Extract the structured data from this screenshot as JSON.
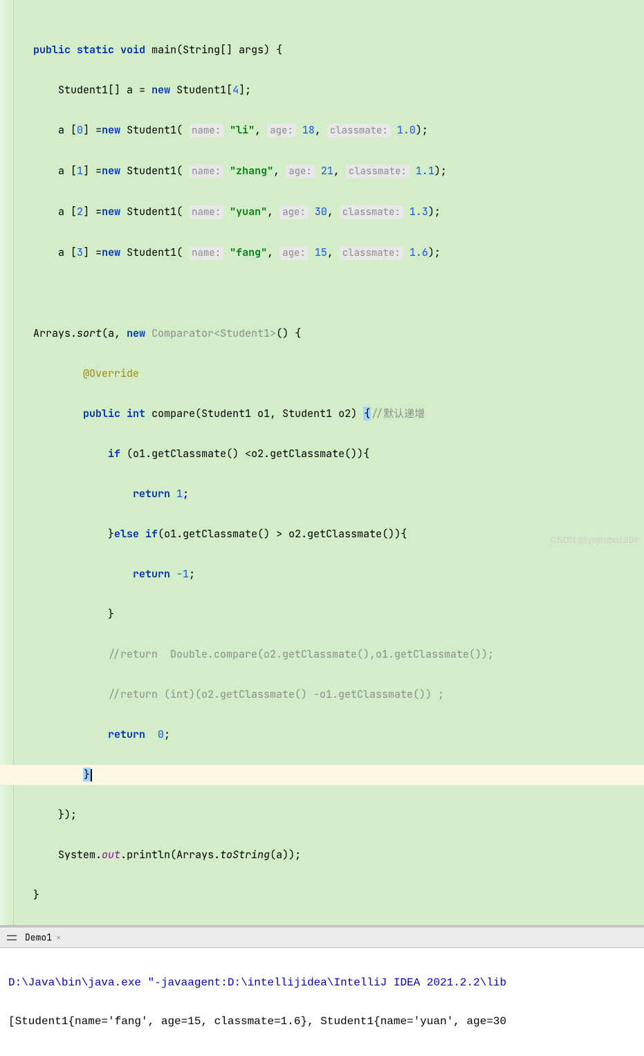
{
  "code": {
    "kw_public": "public",
    "kw_static": "static",
    "kw_void": "void",
    "kw_new": "new",
    "kw_int": "int",
    "kw_if": "if",
    "kw_else": "else",
    "kw_return": "return",
    "main": "main",
    "string": "String",
    "args": "args",
    "student1": "Student1",
    "var_a": "a",
    "arr_size": "4",
    "rows": [
      {
        "idx": "0",
        "name": "\"li\"",
        "age": "18",
        "classmate": "1.0"
      },
      {
        "idx": "1",
        "name": "\"zhang\"",
        "age": "21",
        "classmate": "1.1"
      },
      {
        "idx": "2",
        "name": "\"yuan\"",
        "age": "30",
        "classmate": "1.3"
      },
      {
        "idx": "3",
        "name": "\"fang\"",
        "age": "15",
        "classmate": "1.6"
      }
    ],
    "hint_name": "name:",
    "hint_age": "age:",
    "hint_classmate": "classmate:",
    "arrays": "Arrays",
    "sort": "sort",
    "comparator": "Comparator",
    "override": "@Override",
    "compare": "compare",
    "o1": "o1",
    "o2": "o2",
    "getClassmate": "getClassmate",
    "ret1": "1",
    "retm1": "-1",
    "ret0": "0",
    "comment_default": "//默认递增",
    "comment1": "//return  Double.compare(o2.getClassmate(),o1.getClassmate());",
    "comment2": "//return (int)(o2.getClassmate() -o1.getClassmate()) ;",
    "system": "System",
    "out": "out",
    "println": "println",
    "toString": "toString"
  },
  "tab": {
    "name": "Demo1",
    "close": "×"
  },
  "console": {
    "line1_a": "D:\\Java\\bin\\java.exe ",
    "line1_b": "\"-javaagent:D:\\intellijidea\\IntelliJ IDEA 2021.2.2\\lib",
    "line2": "[Student1{name='fang', age=15, classmate=1.6}, Student1{name='yuan', age=30"
  },
  "watermark": "CSDN @yojimbo1886"
}
